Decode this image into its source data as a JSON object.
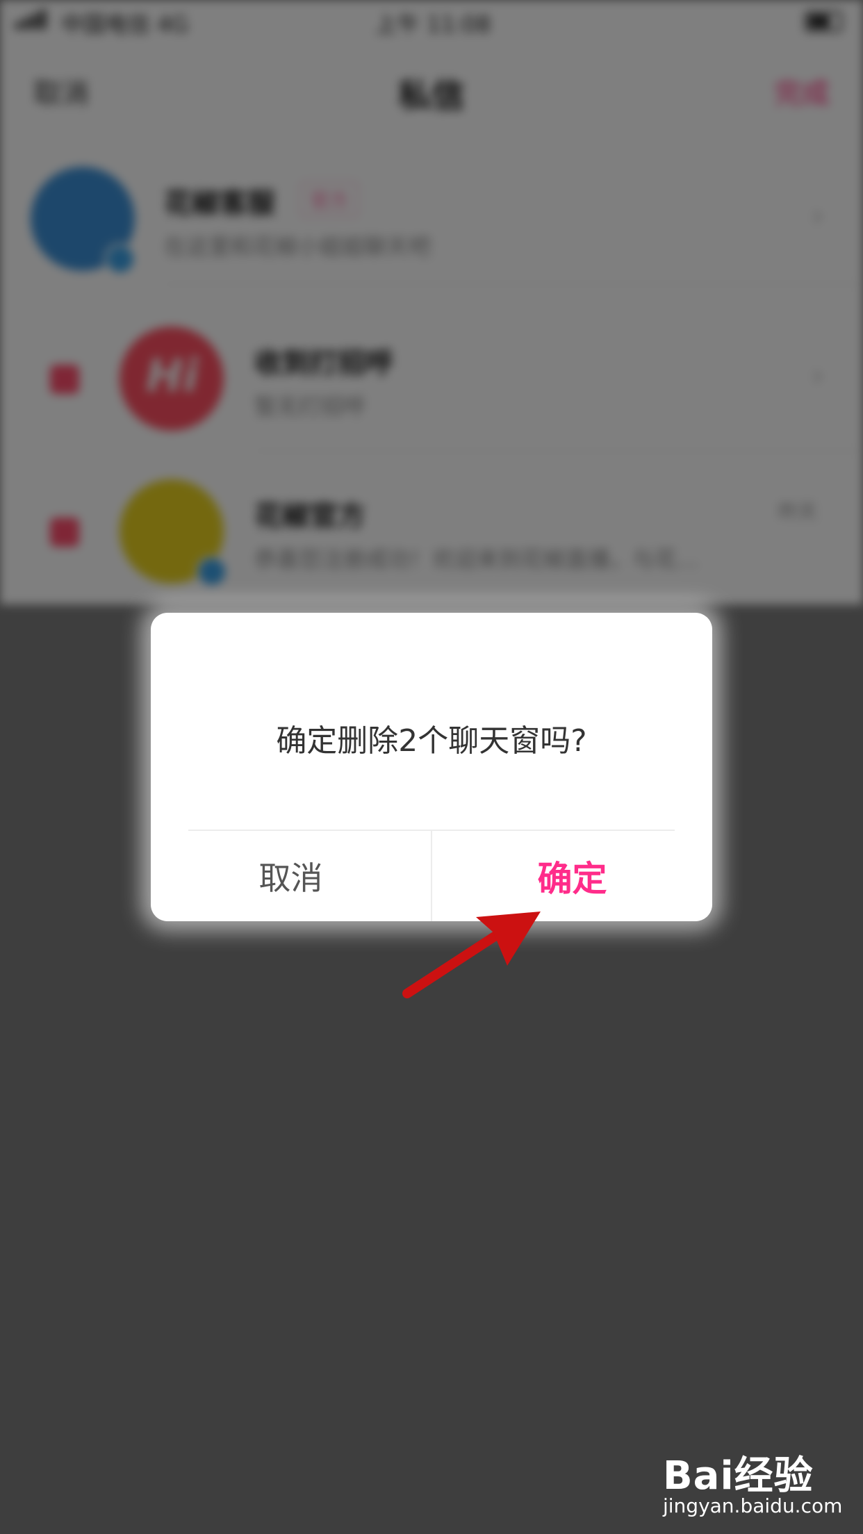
{
  "status_bar": {
    "carrier": "中国电信 4G",
    "time": "上午 11:08"
  },
  "nav": {
    "left_label": "取消",
    "title": "私信",
    "right_label": "完成"
  },
  "chats": [
    {
      "name": "花椒客服",
      "tag": "官方",
      "preview": "在这里和花椒小姐姐聊天吧",
      "time": "",
      "avatar_color": "#3b8fd6"
    },
    {
      "name": "收到打招呼",
      "tag": "",
      "preview": "暂无打招呼",
      "time": "",
      "avatar_color": "#ff4f62",
      "avatar_text": "Hi"
    },
    {
      "name": "花椒官方",
      "tag": "",
      "preview": "恭喜您注册成功！欢迎来到花椒直播，与花…",
      "time": "昨天",
      "avatar_color": "#e8d11f"
    }
  ],
  "dialog": {
    "message": "确定删除2个聊天窗吗?",
    "cancel_label": "取消",
    "confirm_label": "确定"
  },
  "colors": {
    "accent": "#ff2c8a",
    "arrow": "#cc1111"
  },
  "watermark": {
    "logo": "Bai经验",
    "url": "jingyan.baidu.com"
  }
}
